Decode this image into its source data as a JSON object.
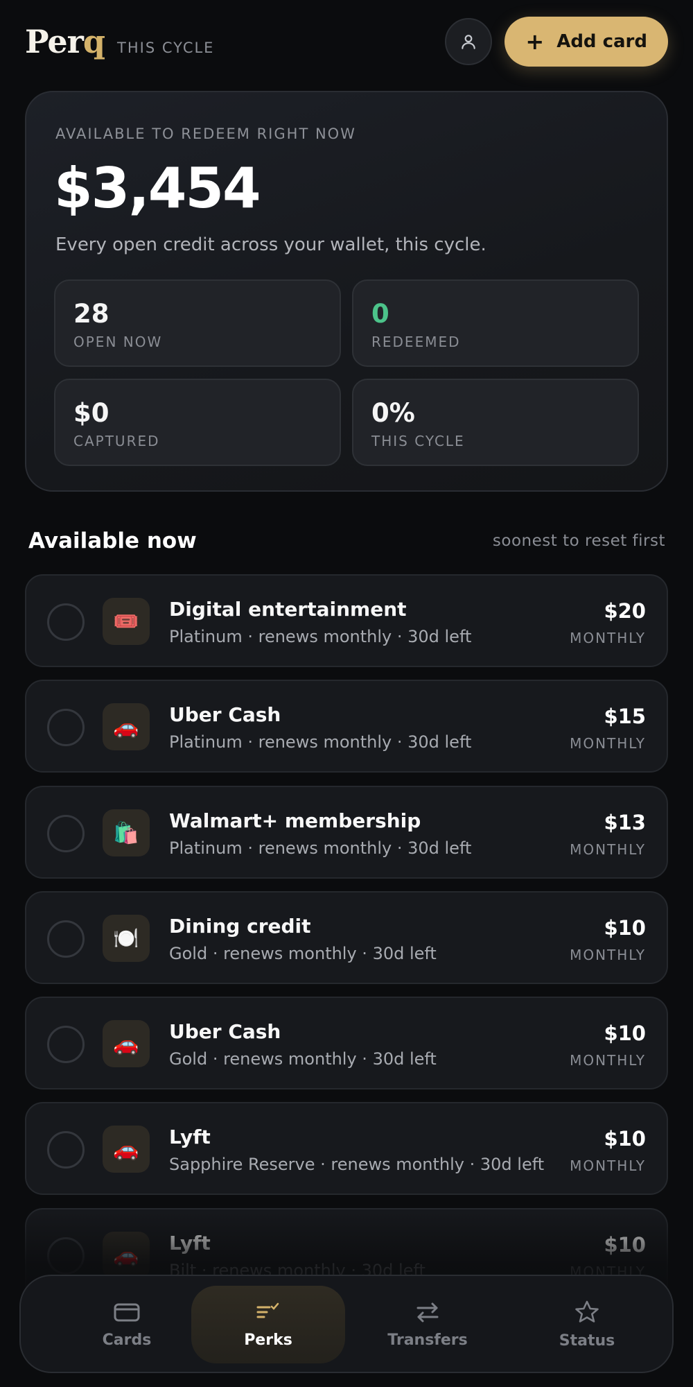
{
  "header": {
    "logo_main": "Per",
    "logo_accent": "q",
    "cycle_label": "THIS CYCLE",
    "add_card_label": "Add card",
    "add_card_icon": "plus-icon",
    "profile_icon": "user-icon"
  },
  "hero": {
    "kicker": "AVAILABLE TO REDEEM RIGHT NOW",
    "amount": "$3,454",
    "subtitle": "Every open credit across your wallet, this cycle.",
    "stats": [
      {
        "value": "28",
        "label": "OPEN NOW"
      },
      {
        "value": "0",
        "label": "REDEEMED",
        "color": "#4cc38a"
      },
      {
        "value": "$0",
        "label": "CAPTURED"
      },
      {
        "value": "0%",
        "label": "THIS CYCLE"
      }
    ]
  },
  "section": {
    "title": "Available now",
    "sort_label": "soonest to reset first"
  },
  "perks": [
    {
      "icon": "🎟️",
      "icon_name": "ticket-icon",
      "name": "Digital entertainment",
      "meta": "Platinum · renews monthly · 30d left",
      "amount": "$20",
      "frequency": "MONTHLY"
    },
    {
      "icon": "🚗",
      "icon_name": "car-icon",
      "name": "Uber Cash",
      "meta": "Platinum · renews monthly · 30d left",
      "amount": "$15",
      "frequency": "MONTHLY"
    },
    {
      "icon": "🛍️",
      "icon_name": "shopping-bags-icon",
      "name": "Walmart+ membership",
      "meta": "Platinum · renews monthly · 30d left",
      "amount": "$13",
      "frequency": "MONTHLY"
    },
    {
      "icon": "🍽️",
      "icon_name": "plate-icon",
      "name": "Dining credit",
      "meta": "Gold · renews monthly · 30d left",
      "amount": "$10",
      "frequency": "MONTHLY"
    },
    {
      "icon": "🚗",
      "icon_name": "car-icon",
      "name": "Uber Cash",
      "meta": "Gold · renews monthly · 30d left",
      "amount": "$10",
      "frequency": "MONTHLY"
    },
    {
      "icon": "🚗",
      "icon_name": "car-icon",
      "name": "Lyft",
      "meta": "Sapphire Reserve · renews monthly · 30d left",
      "amount": "$10",
      "frequency": "MONTHLY"
    },
    {
      "icon": "🚗",
      "icon_name": "car-icon",
      "name": "Lyft",
      "meta": "Bilt · renews monthly · 30d left",
      "amount": "$10",
      "frequency": "MONTHLY"
    }
  ],
  "nav": {
    "items": [
      {
        "label": "Cards",
        "icon": "card-icon",
        "active": false
      },
      {
        "label": "Perks",
        "icon": "perks-list-icon",
        "active": true
      },
      {
        "label": "Transfers",
        "icon": "transfer-arrows-icon",
        "active": false
      },
      {
        "label": "Status",
        "icon": "star-icon",
        "active": false
      }
    ]
  },
  "colors": {
    "accent": "#d9b672",
    "background": "#0b0c0e",
    "success": "#4cc38a"
  }
}
